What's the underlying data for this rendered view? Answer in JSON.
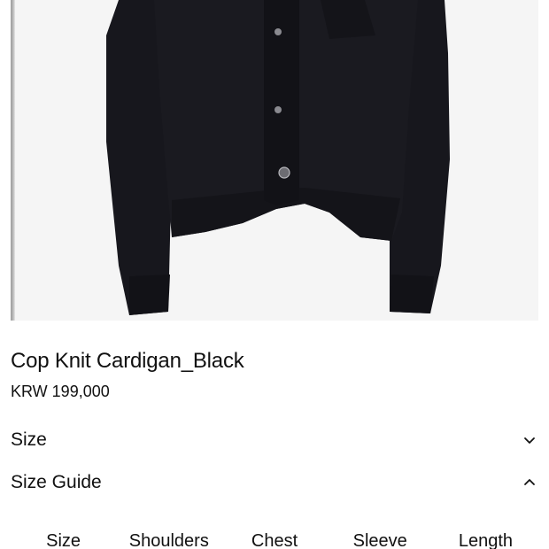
{
  "product": {
    "title": "Cop Knit Cardigan_Black",
    "price": "KRW 199,000",
    "image_alt": "black knit cardigan"
  },
  "accordions": {
    "size": {
      "label": "Size",
      "icon": "chevron-down-icon",
      "expanded": false
    },
    "size_guide": {
      "label": "Size Guide",
      "icon": "chevron-up-icon",
      "expanded": true
    }
  },
  "size_table": {
    "headers": [
      "Size",
      "Shoulders",
      "Chest",
      "Sleeve",
      "Length"
    ]
  },
  "colors": {
    "garment": "#16161c",
    "image_background": "#f5f5f5",
    "text": "#111111"
  }
}
